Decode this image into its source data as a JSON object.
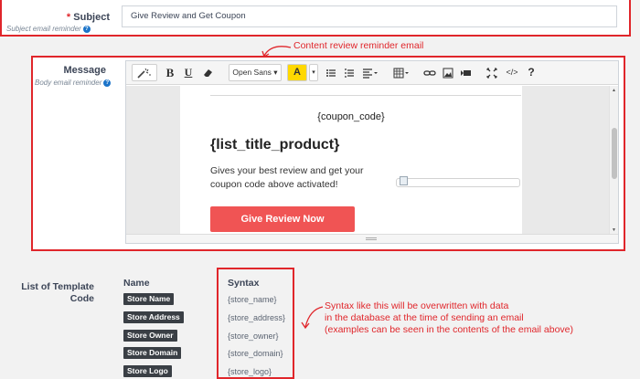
{
  "subject": {
    "label": "Subject",
    "required_mark": "*",
    "hint": "Subject email reminder",
    "value": "Give Review and Get Coupon"
  },
  "annotations": {
    "content_review": "Content review reminder email",
    "syntax_lines": [
      "Syntax like this will be overwritten with data",
      "in the database at the time of sending an email",
      "(examples can be seen in the contents of the email above)"
    ]
  },
  "message": {
    "label": "Message",
    "hint": "Body email reminder",
    "toolbar": {
      "font_name": "Open Sans",
      "bold": "B",
      "underline": "U",
      "highlight": "A",
      "help": "?"
    },
    "preview": {
      "coupon_code": "{coupon_code}",
      "list_title": "{list_title_product}",
      "review_text": "Gives your best review and get your coupon code above activated!",
      "cta_label": "Give Review Now"
    }
  },
  "template_code": {
    "label_line1": "List of Template",
    "label_line2": "Code",
    "name_header": "Name",
    "syntax_header": "Syntax",
    "rows": [
      {
        "name": "Store Name",
        "syntax": "{store_name}"
      },
      {
        "name": "Store Address",
        "syntax": "{store_address}"
      },
      {
        "name": "Store Owner",
        "syntax": "{store_owner}"
      },
      {
        "name": "Store Domain",
        "syntax": "{store_domain}"
      },
      {
        "name": "Store Logo",
        "syntax": "{store_logo}"
      }
    ]
  },
  "colors": {
    "annotation_red": "#e0262b",
    "cta_red": "#f05454",
    "tag_dark": "#3a3f45",
    "help_blue": "#1b74c9"
  }
}
